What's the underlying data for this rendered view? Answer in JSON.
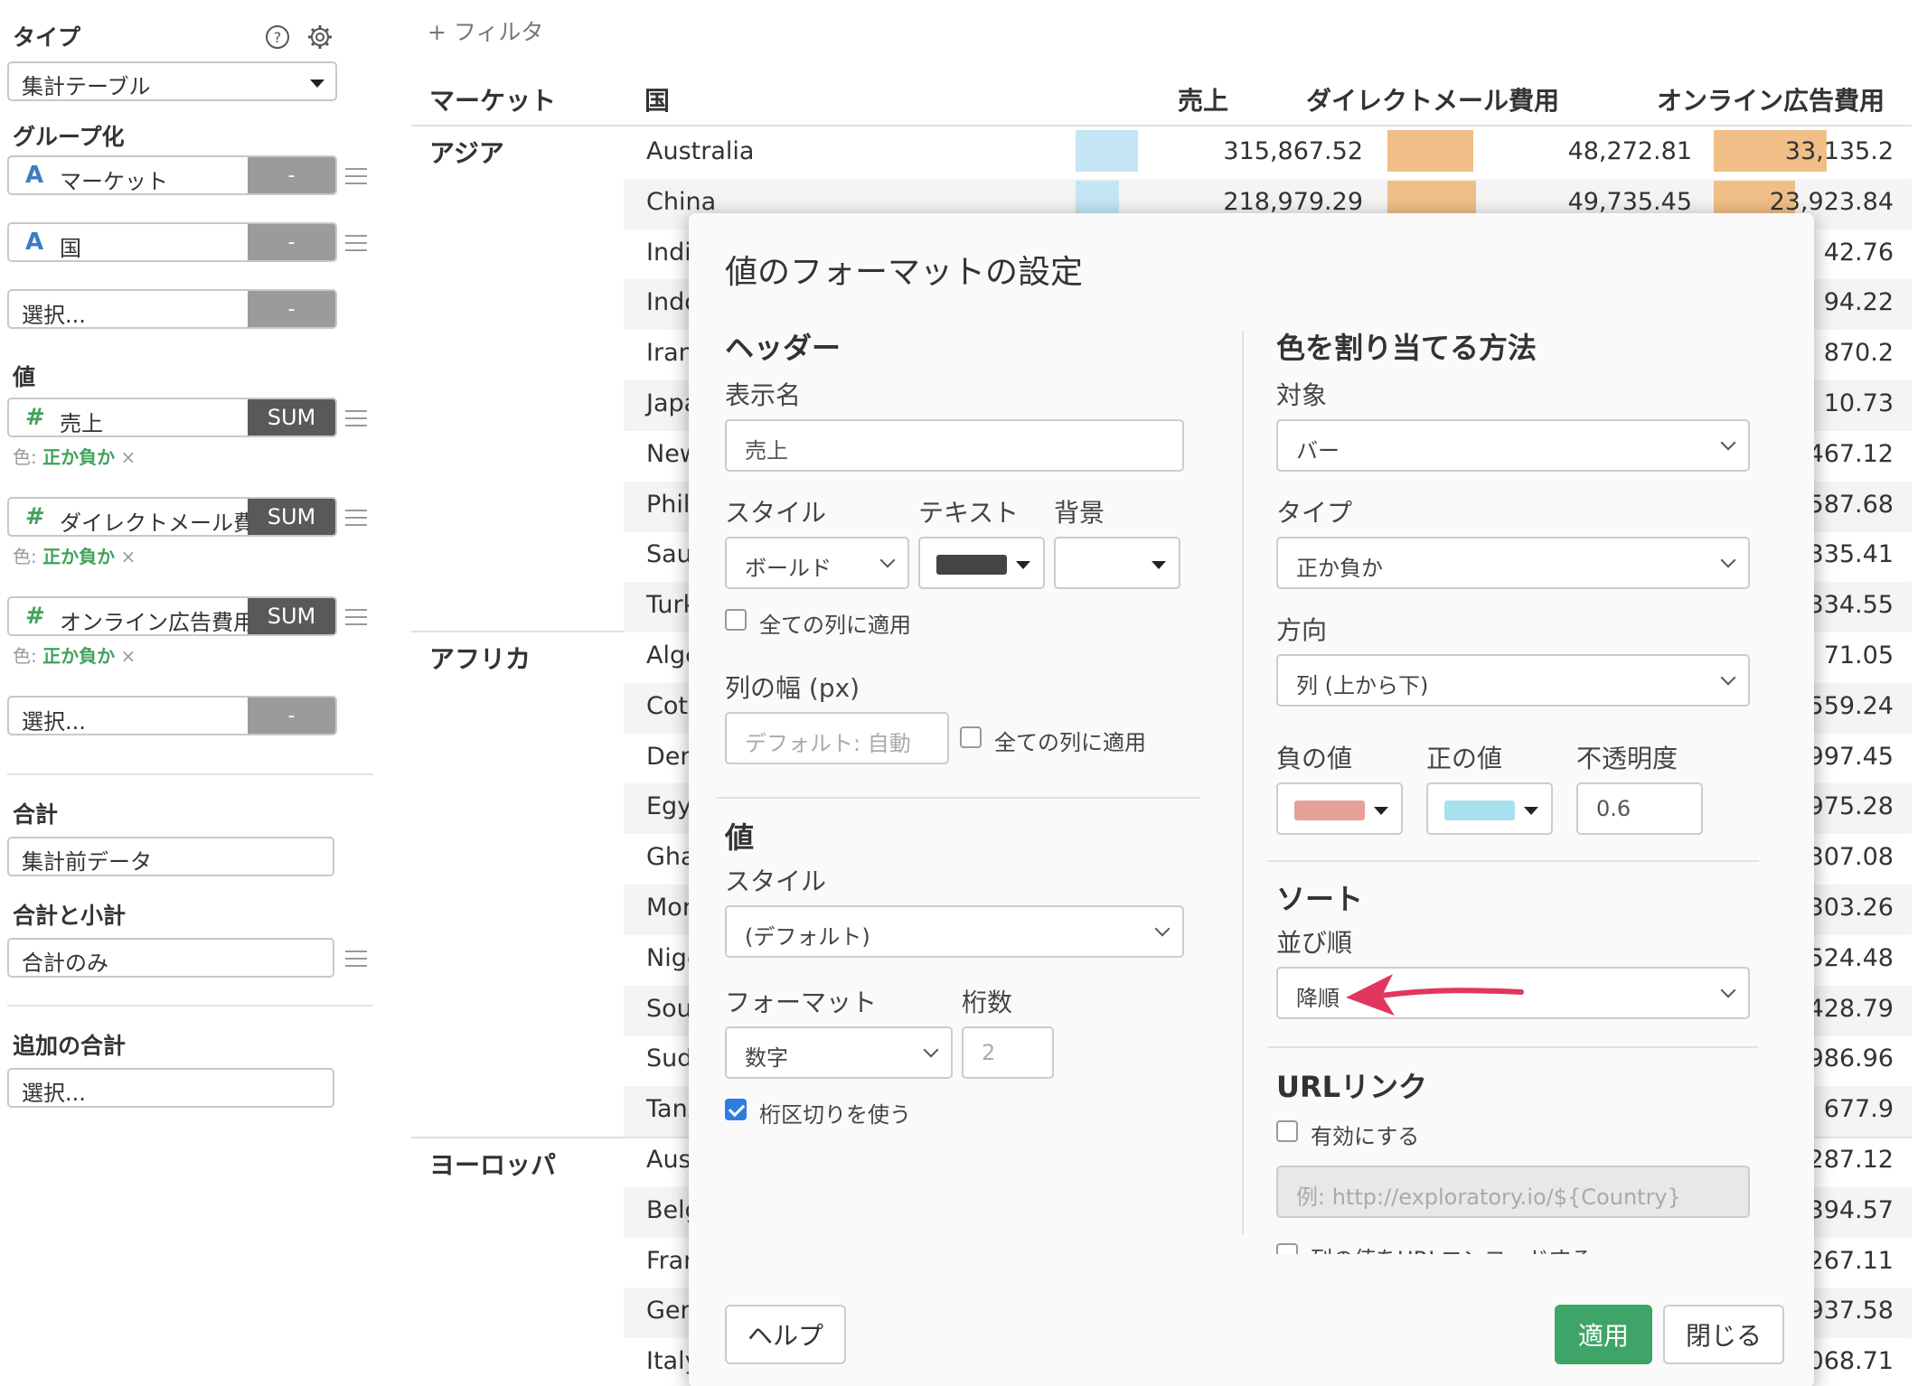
{
  "left_panel": {
    "type_title": "タイプ",
    "type_value": "集計テーブル",
    "group_title": "グループ化",
    "groups": [
      {
        "icon": "A",
        "label": "マーケット",
        "agg": "-"
      },
      {
        "icon": "A",
        "label": "国",
        "agg": "-"
      },
      {
        "icon": "",
        "label": "選択...",
        "agg": "-"
      }
    ],
    "value_title": "値",
    "values": [
      {
        "icon": "#",
        "label": "売上",
        "agg": "SUM",
        "color_prefix": "色: ",
        "color_value": "正か負か",
        "remove": "×"
      },
      {
        "icon": "#",
        "label": "ダイレクトメール費用",
        "agg": "SUM",
        "color_prefix": "色: ",
        "color_value": "正か負か",
        "remove": "×"
      },
      {
        "icon": "#",
        "label": "オンライン広告費用",
        "agg": "SUM",
        "color_prefix": "色: ",
        "color_value": "正か負か",
        "remove": "×"
      }
    ],
    "value_select": {
      "label": "選択...",
      "agg": "-"
    },
    "total_title": "合計",
    "total_value": "集計前データ",
    "subtotal_title": "合計と小計",
    "subtotal_value": "合計のみ",
    "extra_title": "追加の合計",
    "extra_value": "選択..."
  },
  "table": {
    "filter_label": "+ フィルタ",
    "headers": [
      "マーケット",
      "国",
      "売上",
      "ダイレクトメール費用",
      "オンライン広告費用"
    ],
    "markets": [
      "アジア",
      "アフリカ",
      "ヨーロッパ"
    ],
    "rows": [
      {
        "country": "Australia",
        "sales": "315,867.52",
        "mail": "48,272.81",
        "online": "33,135.2",
        "sales_bar": 0.55,
        "mail_bar": 0.97,
        "online_bar": 1.0
      },
      {
        "country": "China",
        "sales": "218,979.29",
        "mail": "49,735.45",
        "online": "23,923.84",
        "sales_bar": 0.38,
        "mail_bar": 1.0,
        "online_bar": 0.72
      },
      {
        "country": "Indi",
        "online": "42.76"
      },
      {
        "country": "Indo",
        "online": "94.22"
      },
      {
        "country": "Iran",
        "online": "870.2"
      },
      {
        "country": "Japa",
        "online": "10.73"
      },
      {
        "country": "New",
        "online": "467.12"
      },
      {
        "country": "Phil",
        "online": "587.68"
      },
      {
        "country": "Sau",
        "online": "335.41"
      },
      {
        "country": "Turk",
        "online": "334.55"
      },
      {
        "country": "Alge",
        "online": "71.05"
      },
      {
        "country": "Cote",
        "online": "559.24"
      },
      {
        "country": "Den",
        "online": "997.45"
      },
      {
        "country": "Egy",
        "online": "975.28"
      },
      {
        "country": "Gha",
        "online": "307.08"
      },
      {
        "country": "Mor",
        "online": "303.26"
      },
      {
        "country": "Nige",
        "online": "524.48"
      },
      {
        "country": "Sou",
        "online": "428.79"
      },
      {
        "country": "Sud",
        "online": "986.96"
      },
      {
        "country": "Tanz",
        "online": "677.9"
      },
      {
        "country": "Aus",
        "online": "287.12"
      },
      {
        "country": "Belg",
        "online": "394.57"
      },
      {
        "country": "Fran",
        "online": "267.11"
      },
      {
        "country": "Ger",
        "online": "937.58"
      },
      {
        "country": "Italy",
        "online": "068.71"
      }
    ]
  },
  "dialog": {
    "title": "値のフォーマットの設定",
    "header_section": "ヘッダー",
    "display_name_label": "表示名",
    "display_name_value": "売上",
    "style_label": "スタイル",
    "text_label": "テキスト",
    "bg_label": "背景",
    "style_value": "ボールド",
    "apply_all_label": "全ての列に適用",
    "col_width_label": "列の幅 (px)",
    "col_width_placeholder": "デフォルト: 自動",
    "col_width_apply_all": "全ての列に適用",
    "value_section": "値",
    "value_style_label": "スタイル",
    "value_style_value": "(デフォルト)",
    "format_label": "フォーマット",
    "digits_label": "桁数",
    "format_value": "数字",
    "digits_value": "2",
    "separator_label": "桁区切りを使う",
    "color_section": "色を割り当てる方法",
    "target_label": "対象",
    "target_value": "バー",
    "type_label": "タイプ",
    "type_value": "正か負か",
    "direction_label": "方向",
    "direction_value": "列 (上から下)",
    "neg_label": "負の値",
    "pos_label": "正の値",
    "opacity_label": "不透明度",
    "opacity_value": "0.6",
    "sort_section": "ソート",
    "order_label": "並び順",
    "order_value": "降順",
    "url_section": "URLリンク",
    "enable_label": "有効にする",
    "url_placeholder": "例: http://exploratory.io/${Country}",
    "encode_label": "列の値をURLエンコードする",
    "help_button": "ヘルプ",
    "apply_button": "適用",
    "close_button": "閉じる"
  },
  "colors": {
    "sales_bar": "#c4e6f4",
    "cost_bar": "#efbf87",
    "negative": "#e8a09a",
    "positive": "#a8e0f0",
    "text_color": "#444444",
    "apply": "#3fa467",
    "arrow": "#e2365f",
    "good_text": "#3fa35a"
  }
}
